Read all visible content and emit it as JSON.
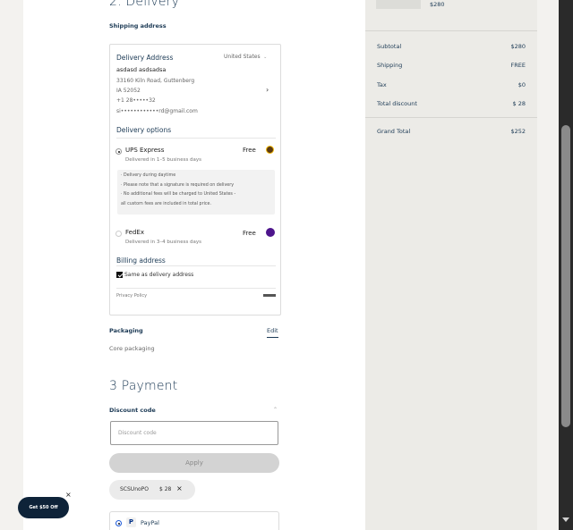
{
  "delivery": {
    "heading": "2. Delivery",
    "shipping_address_label": "Shipping address",
    "card": {
      "title": "Delivery Address",
      "country": "United States",
      "name": "asdasd asdsadsa",
      "street": "33160 Kiln Road, Guttenberg",
      "region": "IA 52052",
      "phone": "+1 28•••••32",
      "email": "si••••••••••••rd@gmail.com",
      "options_title": "Delivery options",
      "options": [
        {
          "name": "UPS Express",
          "eta": "Delivered in 1–5 business days",
          "price": "Free",
          "selected": true,
          "icon": "ups-icon"
        },
        {
          "name": "FedEx",
          "eta": "Delivered in 3–4 business days",
          "price": "Free",
          "selected": false,
          "icon": "fedex-icon"
        }
      ],
      "info_lines": [
        "· Delivery during daytime",
        "· Please note that a signature is required on delivery",
        "· No additional fees will be charged to United States -",
        "all custom fees are included in total price."
      ],
      "billing_title": "Billing address",
      "billing_same": "Same as delivery address",
      "billing_same_checked": true,
      "privacy": "Privacy Policy"
    },
    "packaging_label": "Packaging",
    "packaging_edit": "Edit",
    "packaging_value": "Core packaging"
  },
  "payment": {
    "heading": "3 Payment",
    "discount_label": "Discount code",
    "discount_placeholder": "Discount code",
    "apply_label": "Apply",
    "applied_code": "SCSUnoPO",
    "applied_amount": "$ 28",
    "method_paypal": "PayPal"
  },
  "summary": {
    "top_price": "$280",
    "rows": [
      {
        "label": "Subtotal",
        "value": "$280"
      },
      {
        "label": "Shipping",
        "value": "FREE"
      },
      {
        "label": "Tax",
        "value": "$0"
      },
      {
        "label": "Total discount",
        "value": "$ 28"
      }
    ],
    "grand_total_label": "Grand Total",
    "grand_total_value": "$252"
  },
  "promo": {
    "label": "Get $50 Off",
    "close": "×"
  },
  "colors": {
    "accent": "#1c3a55",
    "ups": "#5b3a12",
    "fedex": "#4d148c",
    "promo_bg": "#0e2339"
  }
}
